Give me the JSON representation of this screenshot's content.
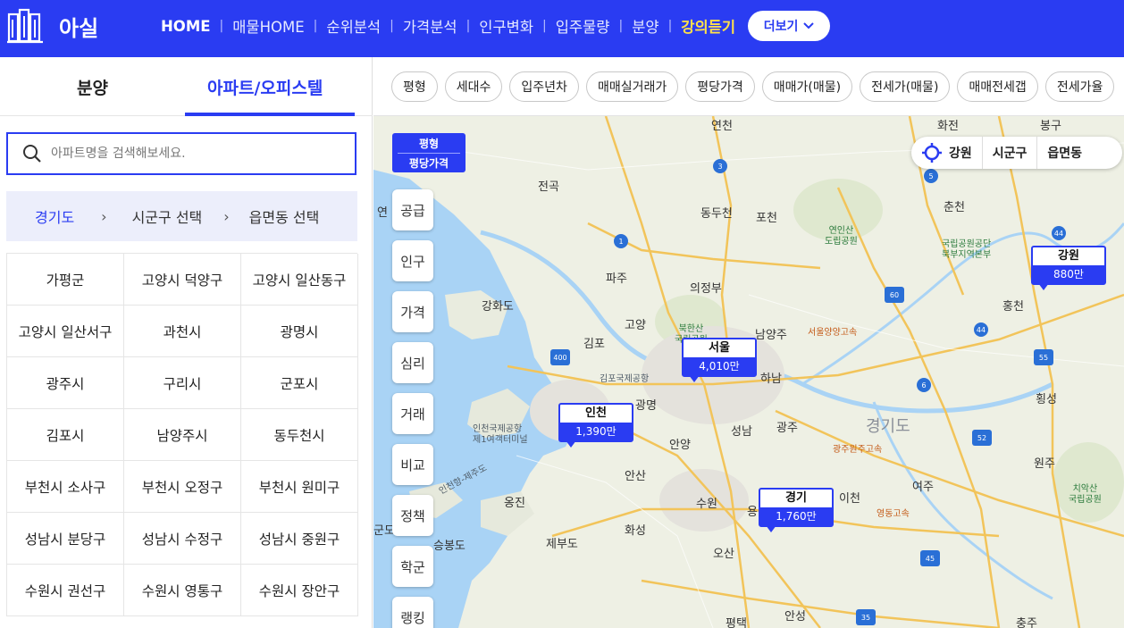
{
  "header": {
    "logo_text": "아실",
    "nav": [
      {
        "label": "HOME",
        "style": "bold"
      },
      {
        "label": "매물HOME",
        "style": "normal"
      },
      {
        "label": "순위분석",
        "style": "normal"
      },
      {
        "label": "가격분석",
        "style": "normal"
      },
      {
        "label": "인구변화",
        "style": "normal"
      },
      {
        "label": "입주물량",
        "style": "normal"
      },
      {
        "label": "분양",
        "style": "normal"
      },
      {
        "label": "강의듣기",
        "style": "accent"
      }
    ],
    "more_label": "더보기",
    "bg_color": "#2a3cf2"
  },
  "left_panel": {
    "tabs": {
      "bunyang": "분양",
      "apt": "아파트/오피스텔"
    },
    "search": {
      "placeholder": "아파트명을 검색해보세요."
    },
    "breadcrumb": {
      "province": "경기도",
      "city": "시군구 선택",
      "town": "읍면동 선택"
    },
    "regions": [
      "가평군",
      "고양시 덕양구",
      "고양시 일산동구",
      "고양시 일산서구",
      "과천시",
      "광명시",
      "광주시",
      "구리시",
      "군포시",
      "김포시",
      "남양주시",
      "동두천시",
      "부천시 소사구",
      "부천시 오정구",
      "부천시 원미구",
      "성남시 분당구",
      "성남시 수정구",
      "성남시 중원구",
      "수원시 권선구",
      "수원시 영통구",
      "수원시 장안구"
    ]
  },
  "filters": [
    "평형",
    "세대수",
    "입주년차",
    "매매실거래가",
    "평당가격",
    "매매가(매물)",
    "전세가(매물)",
    "매매전세갭",
    "전세가율"
  ],
  "map": {
    "pyeong_toggle": {
      "line1": "평형",
      "line2": "평당가격"
    },
    "side_buttons": [
      "공급",
      "인구",
      "가격",
      "심리",
      "거래",
      "비교",
      "정책",
      "학군",
      "랭킹"
    ],
    "region_select": {
      "level1": "강원",
      "level2": "시군구",
      "level3": "읍면동"
    },
    "markers": {
      "seoul": {
        "name": "서울",
        "price": "4,010만"
      },
      "incheon": {
        "name": "인천",
        "price": "1,390만"
      },
      "gyeonggi": {
        "name": "경기",
        "price": "1,760만"
      },
      "gangwon": {
        "name": "강원",
        "price": "880만"
      }
    },
    "places": {
      "yeoncheon": "연천",
      "jeongok": "전곡",
      "dongducheon": "동두천",
      "pocheon": "포천",
      "paju": "파주",
      "uijeongbu": "의정부",
      "goyang": "고양",
      "gimpo": "김포",
      "namyangju": "남양주",
      "hanam": "하남",
      "gwangmyeong": "광명",
      "anyang": "안양",
      "seongnam": "성남",
      "gwangju": "광주",
      "ansan": "안산",
      "suwon": "수원",
      "yongin": "용인",
      "hwaseong": "화성",
      "osan": "오산",
      "pyeongtaek": "평택",
      "anseong": "안성",
      "icheon": "이천",
      "yeoju": "여주",
      "chuncheon": "춘천",
      "hongcheon": "홍천",
      "hoengseong": "횡성",
      "wonju": "원주",
      "ganghwado": "강화도",
      "yeongjong": "옹진",
      "jebudo": "제부도",
      "chungju": "충주",
      "gyeonggido": "경기도",
      "hwajeon": "화전",
      "bonggu": "봉구",
      "yeon": "연",
      "gundo": "군도",
      "seungbongdo": "승봉도",
      "incheon_airport": "인천국제공항\n제1여객터미널",
      "gimpo_airport": "김포국제공항",
      "yeonin_park": "연인산\n도립공원",
      "bukhansan": "북한산\n국립공원",
      "chiaksan": "치악산\n국립공원",
      "seorak_branch": "국립공원공단\n북부지역본부",
      "seoul_yangyang": "서울양양고속",
      "gwangju_wonju": "광주원주고속",
      "yeongdong": "영동고속",
      "incheon_jeju": "인천항-제주도"
    }
  }
}
